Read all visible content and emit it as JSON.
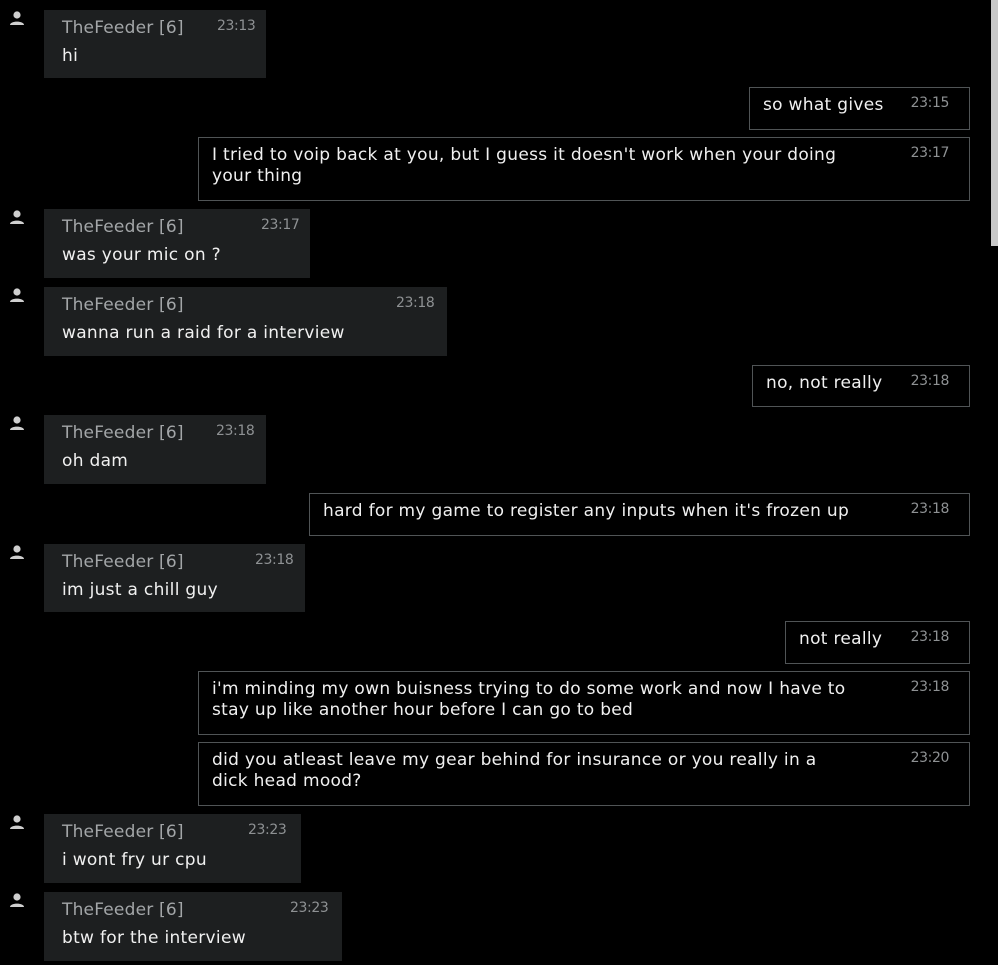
{
  "conversation": {
    "messages": [
      {
        "direction": "in",
        "sender": "TheFeeder [6]",
        "time": "23:13",
        "text": "hi"
      },
      {
        "direction": "out",
        "time": "23:15",
        "text": "so what gives"
      },
      {
        "direction": "out",
        "time": "23:17",
        "text": "I tried to voip back at you, but I guess it doesn't work when your doing\nyour thing"
      },
      {
        "direction": "in",
        "sender": "TheFeeder [6]",
        "time": "23:17",
        "text": "was your mic on ?"
      },
      {
        "direction": "in",
        "sender": "TheFeeder [6]",
        "time": "23:18",
        "text": "wanna run a raid for a interview"
      },
      {
        "direction": "out",
        "time": "23:18",
        "text": "no, not really"
      },
      {
        "direction": "in",
        "sender": "TheFeeder [6]",
        "time": "23:18",
        "text": "oh dam"
      },
      {
        "direction": "out",
        "time": "23:18",
        "text": "hard for my game to register any inputs when it's frozen up"
      },
      {
        "direction": "in",
        "sender": "TheFeeder [6]",
        "time": "23:18",
        "text": "im just a chill guy"
      },
      {
        "direction": "out",
        "time": "23:18",
        "text": "not really"
      },
      {
        "direction": "out",
        "time": "23:18",
        "text": "i'm minding my own buisness trying to do some work and now I have to\nstay up like another hour before I can go to bed"
      },
      {
        "direction": "out",
        "time": "23:20",
        "text": "did you atleast leave my gear behind for insurance or you really in a\ndick head mood?"
      },
      {
        "direction": "in",
        "sender": "TheFeeder [6]",
        "time": "23:23",
        "text": "i wont fry ur cpu"
      },
      {
        "direction": "in",
        "sender": "TheFeeder [6]",
        "time": "23:23",
        "text": "btw for the interview"
      }
    ]
  },
  "icons": {
    "avatar": "user-silhouette-icon"
  },
  "colors": {
    "background": "#000000",
    "incoming_bubble": "#1d1f20",
    "outgoing_border": "#505456",
    "sender_name": "#a3a6a8",
    "timestamp": "#8e9193",
    "message_text": "#f0f0f0"
  }
}
